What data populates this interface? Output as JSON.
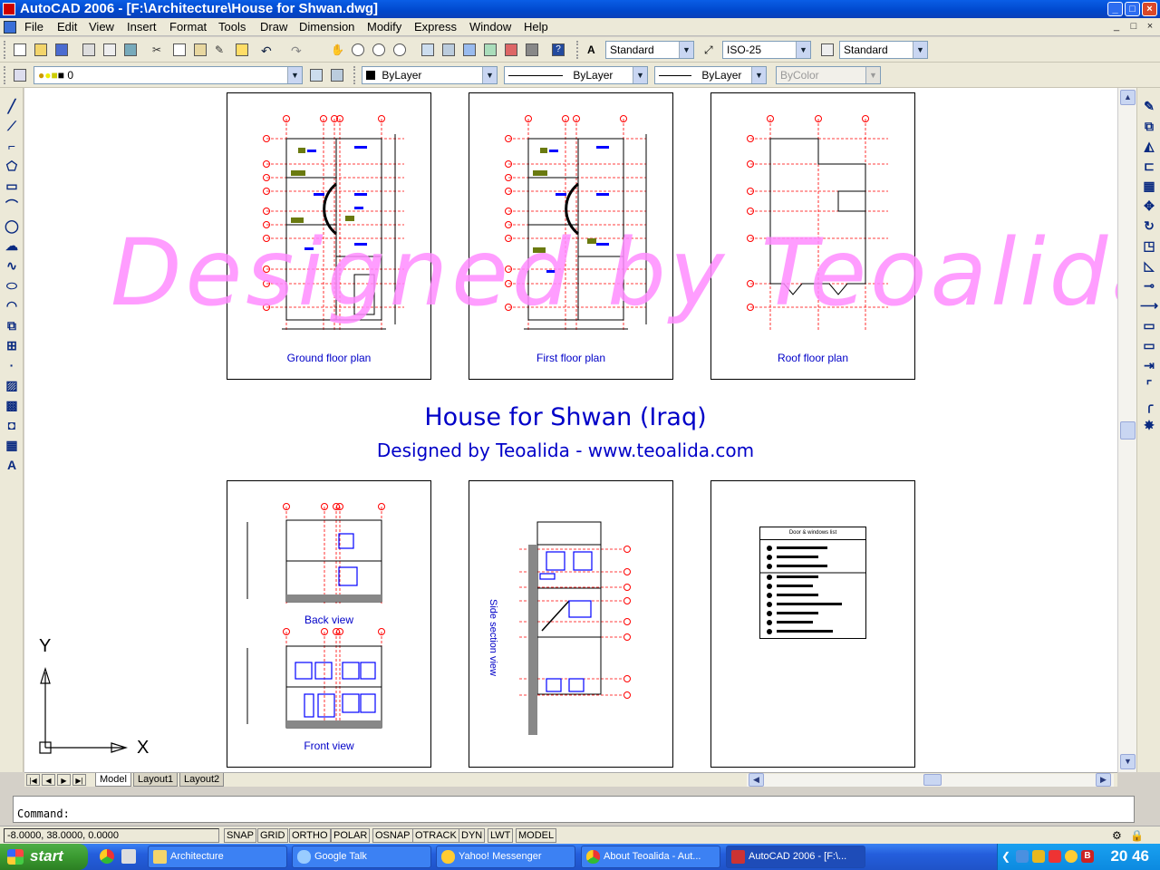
{
  "window": {
    "title": "AutoCAD 2006 - [F:\\Architecture\\House for Shwan.dwg]",
    "minimize": "_",
    "maximize": "□",
    "close": "×"
  },
  "menu": [
    "File",
    "Edit",
    "View",
    "Insert",
    "Format",
    "Tools",
    "Draw",
    "Dimension",
    "Modify",
    "Express",
    "Window",
    "Help"
  ],
  "styles_toolbar": {
    "text_style": "Standard",
    "dim_style": "ISO-25",
    "table_style": "Standard"
  },
  "layers_toolbar": {
    "layer": "0",
    "color": "ByLayer",
    "linetype": "ByLayer",
    "lineweight": "ByLayer",
    "plot_style": "ByColor"
  },
  "drawing": {
    "watermark": "Designed by Teoalida",
    "title": "House for Shwan (Iraq)",
    "subtitle": "Designed by Teoalida - www.teoalida.com",
    "sheets": {
      "ground": "Ground floor plan",
      "first": "First floor plan",
      "roof": "Roof floor plan",
      "back": "Back view",
      "front": "Front view",
      "section": "Side section view",
      "legend_title": "Door & windows list"
    },
    "ucs_x": "X",
    "ucs_y": "Y"
  },
  "tabs": [
    "Model",
    "Layout1",
    "Layout2"
  ],
  "command": {
    "prompt": "Command:"
  },
  "status": {
    "coords": "-8.0000, 38.0000, 0.0000",
    "buttons": [
      "SNAP",
      "GRID",
      "ORTHO",
      "POLAR",
      "OSNAP",
      "OTRACK",
      "DYN",
      "LWT",
      "MODEL"
    ]
  },
  "taskbar": {
    "start": "start",
    "tasks": [
      "Architecture",
      "Google Talk",
      "Yahoo! Messenger",
      "About Teoalida - Aut...",
      "AutoCAD 2006 - [F:\\..."
    ],
    "clock": "20 46"
  },
  "colors": {
    "drawing_blue": "#0000c8",
    "watermark": "#ff8cff",
    "grid_red": "#ff0000",
    "titlebar": "#0047cc"
  }
}
